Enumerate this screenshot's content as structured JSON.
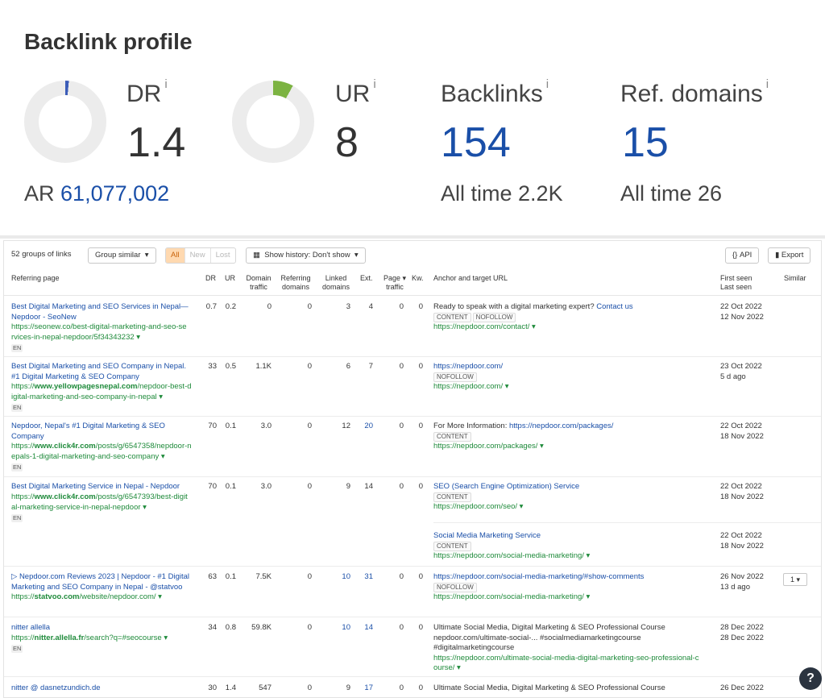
{
  "summary": {
    "title": "Backlink profile",
    "dr": {
      "label": "DR",
      "info": "i",
      "value": "1.4",
      "gauge": 0.014,
      "color": "#3b5cb8"
    },
    "ur": {
      "label": "UR",
      "info": "i",
      "value": "8",
      "gauge": 0.08,
      "color": "#7cb342"
    },
    "ar": {
      "label": "AR",
      "value": "61,077,002"
    },
    "backlinks": {
      "label": "Backlinks",
      "info": "i",
      "value": "154",
      "alltime_label": "All time",
      "alltime_value": "2.2K"
    },
    "ref_domains": {
      "label": "Ref. domains",
      "info": "i",
      "value": "15",
      "alltime_label": "All time",
      "alltime_value": "26"
    }
  },
  "toolbar": {
    "groups_text": "52 groups of links",
    "group_similar": "Group similar",
    "filters": [
      "All",
      "New",
      "Lost"
    ],
    "history": "Show history: Don't show",
    "api": "API",
    "export": "Export"
  },
  "columns": {
    "referring_page": "Referring page",
    "dr": "DR",
    "ur": "UR",
    "domain_traffic": [
      "Domain",
      "traffic"
    ],
    "referring_domains": [
      "Referring",
      "domains"
    ],
    "linked_domains": [
      "Linked",
      "domains"
    ],
    "ext": "Ext.",
    "page_traffic": [
      "Page ▾",
      "traffic"
    ],
    "kw": "Kw.",
    "anchor": "Anchor and target URL",
    "first_last": [
      "First seen",
      "Last seen"
    ],
    "similar": "Similar"
  },
  "rows": [
    {
      "title": [
        "Best Digital Marketing and SEO Services in Nepal—",
        "Nepdoor - SeoNew"
      ],
      "url": [
        "https://seonew.co/best-digital-marketing-and-seo-se",
        "rvices-in-nepal-nepdoor/5f34343232 ▾"
      ],
      "lang": "EN",
      "dr": "0.7",
      "ur": "0.2",
      "traffic": "0",
      "refdom": "0",
      "linked": "3",
      "ext": "4",
      "ptraffic": "0",
      "kw": "0",
      "anchor_text": "Ready to speak with a digital marketing expert?",
      "anchor_link": "Contact us",
      "tags": [
        "CONTENT",
        "NOFOLLOW"
      ],
      "target": "https://nepdoor.com/contact/ ▾",
      "first": "22 Oct 2022",
      "last": "12 Nov 2022"
    },
    {
      "title": [
        "Best Digital Marketing and SEO Company in Nepal.",
        "#1 Digital Marketing & SEO Company"
      ],
      "url_pre": "https://",
      "url_bold": "www.yellowpagesnepal.com",
      "url_post": "/nepdoor-best-d",
      "url2": "igital-marketing-and-seo-company-in-nepal ▾",
      "lang": "EN",
      "dr": "33",
      "ur": "0.5",
      "traffic": "1.1K",
      "refdom": "0",
      "linked": "6",
      "ext": "7",
      "ptraffic": "0",
      "kw": "0",
      "anchor_link": "https://nepdoor.com/",
      "tags": [
        "NOFOLLOW"
      ],
      "target": "https://nepdoor.com/ ▾",
      "first": "23 Oct 2022",
      "last": "5 d ago"
    },
    {
      "title": [
        "Nepdoor, Nepal's #1 Digital Marketing & SEO",
        "Company"
      ],
      "url_pre": "https://",
      "url_bold": "www.click4r.com",
      "url_post": "/posts/g/6547358/nepdoor-n",
      "url2": "epals-1-digital-marketing-and-seo-company ▾",
      "lang": "EN",
      "dr": "70",
      "ur": "0.1",
      "traffic": "3.0",
      "refdom": "0",
      "linked": "12",
      "ext": "20",
      "ptraffic": "0",
      "kw": "0",
      "anchor_text": "For More Information:",
      "anchor_link": "https://nepdoor.com/packages/",
      "tags": [
        "CONTENT"
      ],
      "target": "https://nepdoor.com/packages/ ▾",
      "first": "22 Oct 2022",
      "last": "18 Nov 2022"
    },
    {
      "title": [
        "Best Digital Marketing Service in Nepal - Nepdoor"
      ],
      "url_pre": "https://",
      "url_bold": "www.click4r.com",
      "url_post": "/posts/g/6547393/best-digit",
      "url2": "al-marketing-service-in-nepal-nepdoor ▾",
      "lang": "EN",
      "dr": "70",
      "ur": "0.1",
      "traffic": "3.0",
      "refdom": "0",
      "linked": "9",
      "ext": "14",
      "ptraffic": "0",
      "kw": "0",
      "anchor_link": "SEO (Search Engine Optimization) Service",
      "tags": [
        "CONTENT"
      ],
      "target": "https://nepdoor.com/seo/ ▾",
      "first": "22 Oct 2022",
      "last": "18 Nov 2022",
      "extra": {
        "anchor_link": "Social Media Marketing Service",
        "tags": [
          "CONTENT"
        ],
        "target": "https://nepdoor.com/social-media-marketing/ ▾",
        "first": "22 Oct 2022",
        "last": "18 Nov 2022"
      }
    },
    {
      "title": [
        "▷ Nepdoor.com Reviews 2023 | Nepdoor - #1 Digital",
        "Marketing and SEO Company in Nepal - @statvoo"
      ],
      "url_pre": "https://",
      "url_bold": "statvoo.com",
      "url_post": "/website/nepdoor.com/ ▾",
      "dr": "63",
      "ur": "0.1",
      "traffic": "7.5K",
      "refdom": "0",
      "linked": "10",
      "ext": "31",
      "ptraffic": "0",
      "kw": "0",
      "anchor_link": "https://nepdoor.com/social-media-marketing/#show-comments",
      "tags": [
        "NOFOLLOW"
      ],
      "target": "https://nepdoor.com/social-media-marketing/ ▾",
      "first": "26 Nov 2022",
      "last": "13 d ago",
      "similar": "1 ▾"
    },
    {
      "title": [
        "nitter allella"
      ],
      "url_pre": "https://",
      "url_bold": "nitter.allella.fr",
      "url_post": "/search?q=#seocourse ▾",
      "lang": "EN",
      "dr": "34",
      "ur": "0.8",
      "traffic": "59.8K",
      "refdom": "0",
      "linked": "10",
      "ext": "14",
      "ptraffic": "0",
      "kw": "0",
      "anchor_text": "Ultimate Social Media, Digital Marketing & SEO Professional Course",
      "anchor_sub": "nepdoor.com/ultimate-social-...  #socialmediamarketingcourse",
      "anchor_sub2": "#digitalmarketingcourse",
      "target": "https://nepdoor.com/ultimate-social-media-digital-marketing-seo-professional-c",
      "target2": "ourse/ ▾",
      "first": "28 Dec 2022",
      "last": "28 Dec 2022"
    },
    {
      "title": [
        "nitter @ dasnetzundich.de"
      ],
      "dr": "30",
      "ur": "1.4",
      "traffic": "547",
      "refdom": "0",
      "linked": "9",
      "ext": "17",
      "ptraffic": "0",
      "kw": "0",
      "anchor_text": "Ultimate Social Media, Digital Marketing & SEO Professional Course",
      "first": "26 Dec 2022"
    }
  ],
  "help": "?"
}
